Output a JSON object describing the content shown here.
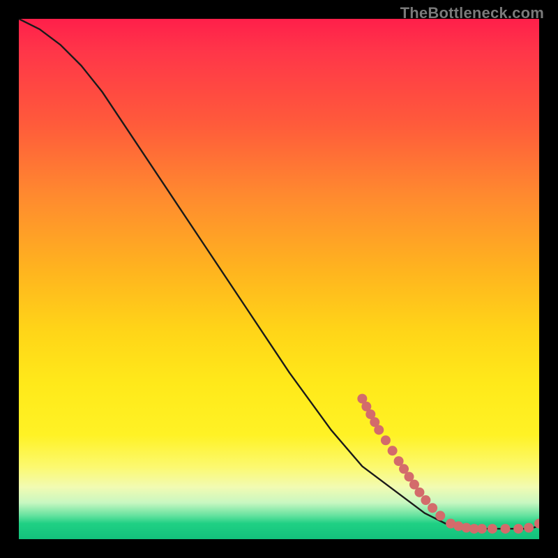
{
  "watermark": "TheBottleneck.com",
  "colors": {
    "curve": "#1a1a1a",
    "dot_fill": "#d36b6b",
    "dot_stroke": "#b84f4f"
  },
  "chart_data": {
    "type": "line",
    "title": "",
    "xlabel": "",
    "ylabel": "",
    "xlim": [
      0,
      100
    ],
    "ylim": [
      0,
      100
    ],
    "series": [
      {
        "name": "curve",
        "x": [
          0,
          4,
          8,
          12,
          16,
          20,
          28,
          36,
          44,
          52,
          60,
          66,
          70,
          74,
          78,
          82,
          86,
          90,
          94,
          98,
          100
        ],
        "y": [
          100,
          98,
          95,
          91,
          86,
          80,
          68,
          56,
          44,
          32,
          21,
          14,
          11,
          8,
          5,
          3,
          2,
          2,
          2,
          2,
          2.5
        ]
      }
    ],
    "dots": [
      {
        "x": 66.0,
        "y": 27.0
      },
      {
        "x": 66.8,
        "y": 25.5
      },
      {
        "x": 67.6,
        "y": 24.0
      },
      {
        "x": 68.4,
        "y": 22.5
      },
      {
        "x": 69.2,
        "y": 21.0
      },
      {
        "x": 70.5,
        "y": 19.0
      },
      {
        "x": 71.8,
        "y": 17.0
      },
      {
        "x": 73.0,
        "y": 15.0
      },
      {
        "x": 74.0,
        "y": 13.5
      },
      {
        "x": 75.0,
        "y": 12.0
      },
      {
        "x": 76.0,
        "y": 10.5
      },
      {
        "x": 77.0,
        "y": 9.0
      },
      {
        "x": 78.2,
        "y": 7.5
      },
      {
        "x": 79.5,
        "y": 6.0
      },
      {
        "x": 81.0,
        "y": 4.5
      },
      {
        "x": 83.0,
        "y": 3.0
      },
      {
        "x": 84.5,
        "y": 2.5
      },
      {
        "x": 86.0,
        "y": 2.2
      },
      {
        "x": 87.5,
        "y": 2.0
      },
      {
        "x": 89.0,
        "y": 2.0
      },
      {
        "x": 91.0,
        "y": 2.0
      },
      {
        "x": 93.5,
        "y": 2.0
      },
      {
        "x": 96.0,
        "y": 2.0
      },
      {
        "x": 98.0,
        "y": 2.2
      },
      {
        "x": 100.0,
        "y": 3.0
      }
    ]
  }
}
